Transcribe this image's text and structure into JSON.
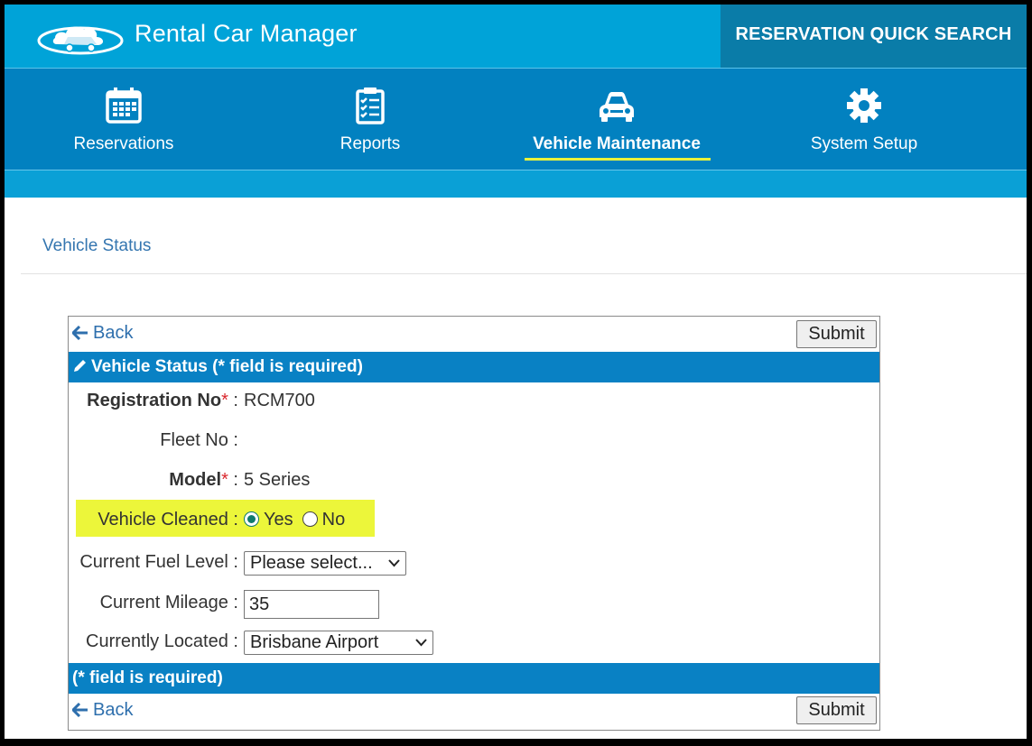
{
  "header": {
    "app_title": "Rental Car Manager",
    "quick_search": "RESERVATION QUICK SEARCH",
    "logo_icon": "cloud-car-logo-icon"
  },
  "nav": {
    "items": [
      {
        "label": "Reservations",
        "icon": "calendar-icon"
      },
      {
        "label": "Reports",
        "icon": "checklist-icon"
      },
      {
        "label": "Vehicle Maintenance",
        "icon": "car-icon",
        "active": true
      },
      {
        "label": "System Setup",
        "icon": "gear-icon"
      }
    ],
    "active_underline_color": "#eaf23a"
  },
  "page": {
    "section_title": "Vehicle Status"
  },
  "panel": {
    "back_label": "Back",
    "submit_label": "Submit",
    "header_bar": "Vehicle Status (* field is required)",
    "footer_bar": "(* field is required)",
    "fields": {
      "registration": {
        "label": "Registration No",
        "required_mark": "*",
        "separator": " :",
        "value": "RCM700"
      },
      "fleet": {
        "label": "Fleet No",
        "separator": " :",
        "value": ""
      },
      "model": {
        "label": "Model",
        "required_mark": "*",
        "separator": " :",
        "value": "5 Series"
      },
      "cleaned": {
        "label": "Vehicle Cleaned",
        "separator": " :",
        "options": [
          "Yes",
          "No"
        ],
        "selected": "Yes"
      },
      "fuel": {
        "label": "Current Fuel Level",
        "separator": " :",
        "selected": "Please select..."
      },
      "mileage": {
        "label": "Current Mileage",
        "separator": " :",
        "value": "35"
      },
      "located": {
        "label": "Currently Located",
        "separator": " :",
        "selected": "Brisbane Airport"
      }
    }
  },
  "colors": {
    "top_bar": "#00a3d8",
    "nav_bar": "#0281c0",
    "quick_search_bg": "#0a7ca8",
    "panel_bar": "#0981c4",
    "highlight": "#ecf63a",
    "link": "#2e6fad"
  }
}
